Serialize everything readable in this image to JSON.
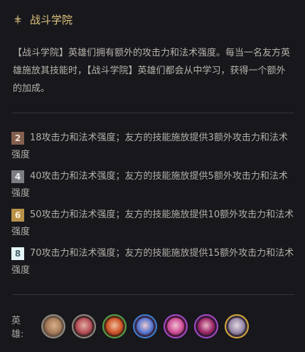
{
  "trait": {
    "icon": "crossed-swords-icon",
    "title": "战斗学院",
    "description": "【战斗学院】英雄们拥有额外的攻击力和法术强度。每当一名友方英雄施放其技能时，【战斗学院】英雄们都会从中学习，获得一个额外的加成。"
  },
  "tiers": [
    {
      "count": "2",
      "tier": "bronze",
      "text": "18攻击力和法术强度；友方的技能施放提供3额外攻击力和法术强度"
    },
    {
      "count": "4",
      "tier": "silver",
      "text": "40攻击力和法术强度；友方的技能施放提供5额外攻击力和法术强度"
    },
    {
      "count": "6",
      "tier": "gold",
      "text": "50攻击力和法术强度；友方的技能施放提供10额外攻击力和法术强度"
    },
    {
      "count": "8",
      "tier": "chromatic",
      "text": "70攻击力和法术强度；友方的技能施放提供15额外攻击力和法术强度"
    }
  ],
  "champions": {
    "label": "英雄:",
    "items": [
      {
        "icon": "champion-portrait-icon",
        "border": "#8e8a84"
      },
      {
        "icon": "champion-portrait-icon",
        "border": "#8e8a84"
      },
      {
        "icon": "champion-portrait-icon",
        "border": "#4fa34a"
      },
      {
        "icon": "champion-portrait-icon",
        "border": "#3c7fd0"
      },
      {
        "icon": "champion-portrait-icon",
        "border": "#a24bc9"
      },
      {
        "icon": "champion-portrait-icon",
        "border": "#a24bc9"
      },
      {
        "icon": "champion-portrait-icon",
        "border": "#d6a83a"
      }
    ]
  },
  "colors": {
    "title": "#e0c47e",
    "background": "#17171c",
    "divider": "#35343b"
  }
}
